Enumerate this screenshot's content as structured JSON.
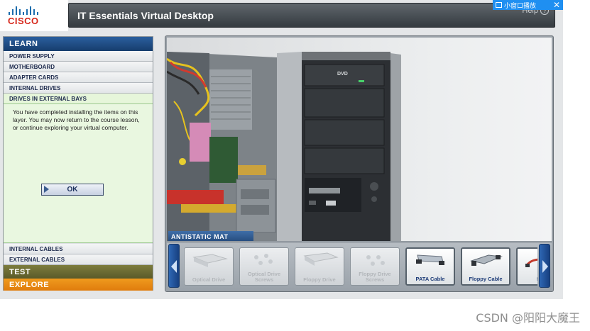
{
  "app": {
    "logo_text": "CISCO",
    "title": "IT Essentials Virtual Desktop",
    "help_label": "Help"
  },
  "popup_tab": {
    "label": "小窗口播放",
    "close_icon": "close-icon"
  },
  "sidebar": {
    "learn_label": "LEARN",
    "items": [
      {
        "label": "POWER SUPPLY"
      },
      {
        "label": "MOTHERBOARD"
      },
      {
        "label": "ADAPTER CARDS"
      },
      {
        "label": "INTERNAL DRIVES"
      },
      {
        "label": "DRIVES IN EXTERNAL BAYS"
      }
    ],
    "message": "You have completed installing the items on this layer. You may now return to the course lesson, or continue exploring your virtual computer.",
    "ok_label": "OK",
    "bottom_items": [
      {
        "label": "INTERNAL CABLES"
      },
      {
        "label": "EXTERNAL CABLES"
      }
    ],
    "test_label": "TEST",
    "explore_label": "EXPLORE"
  },
  "main": {
    "mat_label": "ANTISTATIC MAT",
    "dvd_label": "DVD",
    "components": [
      {
        "label": "Optical Drive",
        "enabled": false
      },
      {
        "label": "Optical Drive Screws",
        "enabled": false
      },
      {
        "label": "Floppy Drive",
        "enabled": false
      },
      {
        "label": "Floppy Drive Screws",
        "enabled": false
      },
      {
        "label": "PATA Cable",
        "enabled": true
      },
      {
        "label": "Floppy Cable",
        "enabled": true
      },
      {
        "label": "S C",
        "enabled": true
      }
    ]
  },
  "watermark": "CSDN @阳阳大魔王",
  "colors": {
    "learn": "#1f4f8a",
    "test": "#6d6c34",
    "explore": "#e8890f",
    "active_item": "#e6f6da"
  }
}
